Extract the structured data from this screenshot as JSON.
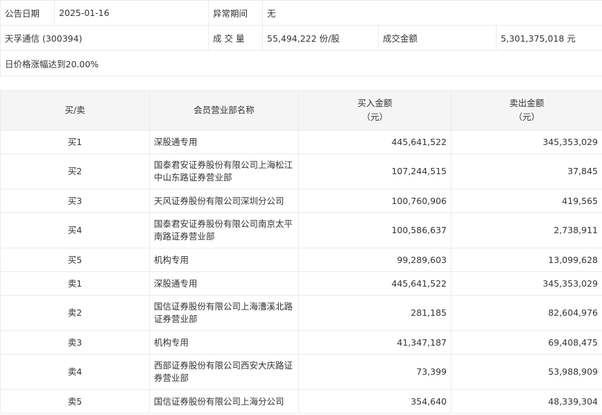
{
  "info": {
    "date_label": "公告日期",
    "date_value": "2025-01-16",
    "period_label": "异常期间",
    "period_value": "无",
    "stock": "天孚通信 (300394)",
    "volume_label": "成 交 量",
    "volume_value": "55,494,222 份/股",
    "amount_label": "成交金额",
    "amount_value": "5,301,375,018 元",
    "reason": "日价格涨幅达到20.00%"
  },
  "table": {
    "headers": [
      "买/卖",
      "会员营业部名称",
      "买入金额",
      "（元）",
      "卖出金额",
      "（元）"
    ],
    "rows": [
      {
        "side": "买1",
        "name": "深股通专用",
        "buy": "445,641,522",
        "sell": "345,353,029"
      },
      {
        "side": "买2",
        "name": "国泰君安证券股份有限公司上海松江中山东路证券营业部",
        "buy": "107,244,515",
        "sell": "37,845"
      },
      {
        "side": "买3",
        "name": "天风证券股份有限公司深圳分公司",
        "buy": "100,760,906",
        "sell": "419,565"
      },
      {
        "side": "买4",
        "name": "国泰君安证券股份有限公司南京太平南路证券营业部",
        "buy": "100,586,637",
        "sell": "2,738,911"
      },
      {
        "side": "买5",
        "name": "机构专用",
        "buy": "99,289,603",
        "sell": "13,099,628"
      },
      {
        "side": "卖1",
        "name": "深股通专用",
        "buy": "445,641,522",
        "sell": "345,353,029"
      },
      {
        "side": "卖2",
        "name": "国信证券股份有限公司上海漕溪北路证券营业部",
        "buy": "281,185",
        "sell": "82,604,976"
      },
      {
        "side": "卖3",
        "name": "机构专用",
        "buy": "41,347,187",
        "sell": "69,408,475"
      },
      {
        "side": "卖4",
        "name": "西部证券股份有限公司西安大庆路证券营业部",
        "buy": "73,399",
        "sell": "53,988,909"
      },
      {
        "side": "卖5",
        "name": "国信证券股份有限公司上海分公司",
        "buy": "354,640",
        "sell": "48,339,304"
      }
    ]
  }
}
